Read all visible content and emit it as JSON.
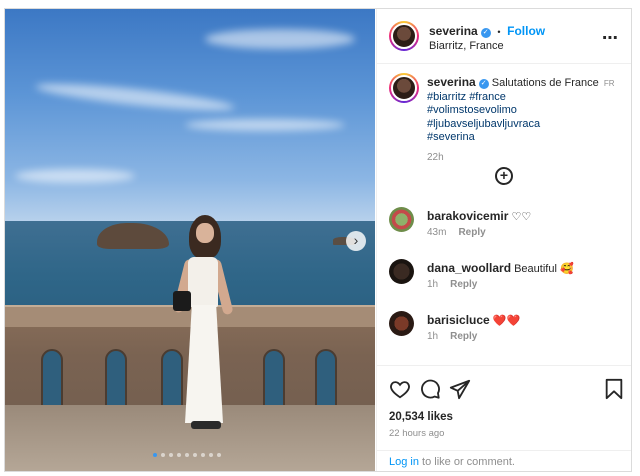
{
  "post": {
    "image_alt_visible": "",
    "slide_count": 9,
    "active_slide": 1
  },
  "header": {
    "username": "severina",
    "separator": "•",
    "follow_label": "Follow",
    "location": "Biarritz, France",
    "more_label": "•••"
  },
  "caption": {
    "username": "severina",
    "text": "Salutations de France",
    "translate_badge": "FR",
    "hashtags": [
      "#biarritz",
      "#france",
      "#volimstosevolimo",
      "#ljubavseljubavljuvraca",
      "#severina"
    ],
    "time": "22h"
  },
  "comments": [
    {
      "username": "barakovicemir",
      "text": "♡♡",
      "time": "43m",
      "reply": "Reply"
    },
    {
      "username": "dana_woollard",
      "text": "Beautiful 🥰",
      "time": "1h",
      "reply": "Reply"
    },
    {
      "username": "barisicluce",
      "text": "❤️❤️",
      "time": "1h",
      "reply": "Reply"
    }
  ],
  "actions": {
    "likes": "20,534 likes",
    "posted_ago": "22 hours ago",
    "login_link": "Log in",
    "login_rest": " to like or comment."
  },
  "colors": {
    "accent": "#0095f6",
    "verified": "#3897f0",
    "muted": "#8e8e8e"
  },
  "icons": {
    "next": "chevron-right-icon",
    "more": "more-horizontal-icon",
    "add_comment": "plus-circle-icon",
    "like": "heart-icon",
    "comment": "comment-bubble-icon",
    "share": "send-icon",
    "save": "bookmark-icon"
  }
}
